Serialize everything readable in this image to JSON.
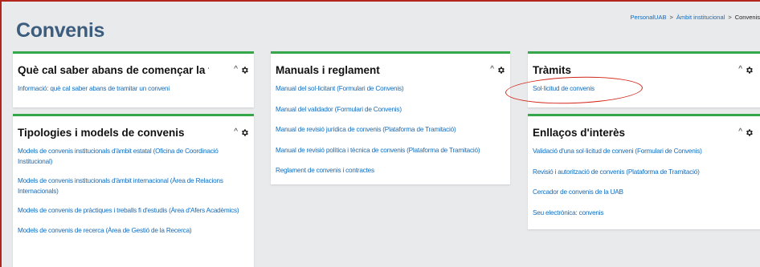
{
  "breadcrumb": {
    "items": [
      "PersonalUAB",
      "Àmbit institucional"
    ],
    "current": "Convenis",
    "separator": ">"
  },
  "page_title": "Convenis",
  "blocks": {
    "que_cal_saber": {
      "title": "Què cal saber abans de començar la t...",
      "links": [
        "Informació: què cal saber abans de tramitar un conveni"
      ]
    },
    "tipologies": {
      "title": "Tipologies i models de convenis",
      "links": [
        "Models de convenis institucionals d'àmbit estatal (Oficina de Coordinació Institucional)",
        "Models de convenis institucionals d'àmbit internacional (Àrea de Relacions Internacionals)",
        "Models de convenis de pràctiques i treballs fi d'estudis (Àrea d'Afers Acadèmics)",
        "Models de convenis de recerca (Àrea de Gestió de la Recerca)"
      ]
    },
    "manuals": {
      "title": "Manuals i reglament",
      "links": [
        "Manual del sol·licitant (Formulari de Convenis)",
        "Manual del validador (Formulari de Convenis)",
        "Manual de revisió jurídica de convenis (Plataforma de Tramitació)",
        "Manual de revisió política i tècnica de convenis (Plataforma de Tramitació)",
        "Reglament de convenis i contractes"
      ]
    },
    "tramits": {
      "title": "Tràmits",
      "links": [
        "Sol·licitud de convenis"
      ]
    },
    "enllacos": {
      "title": "Enllaços d'interès",
      "links": [
        "Validació d'una sol·licitud de conveni (Formulari de Convenis)",
        "Revisió i autorització de convenis (Plataforma de Tramitació)",
        "Cercador de convenis de la UAB",
        "Seu electrònica: convenis"
      ]
    }
  },
  "icons": {
    "collapse": "chevron-up-icon",
    "settings": "gear-icon"
  },
  "colors": {
    "accent_green": "#35a74b",
    "link_blue": "#0f6cbf",
    "title_blue": "#3d5d7e",
    "annotation_red": "#d22518",
    "background": "#e9eaec"
  }
}
